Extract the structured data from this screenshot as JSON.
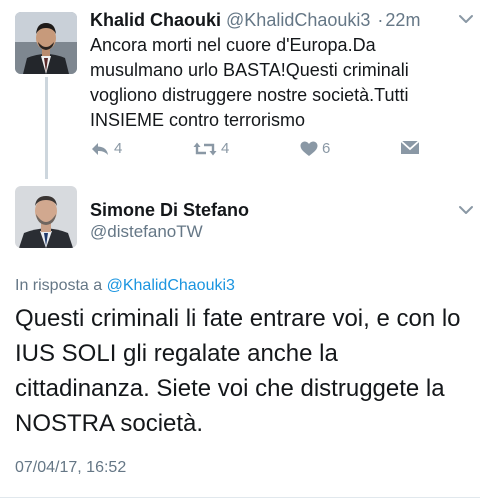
{
  "parent_tweet": {
    "author_name": "Khalid Chaouki",
    "author_handle": "@KhalidChaouki3",
    "separator": "·",
    "time_ago": "22m",
    "text_lines": [
      "Ancora morti nel cuore d'Europa.Da",
      "musulmano urlo BASTA!Questi criminali",
      "vogliono distruggere nostre società.Tutti",
      "INSIEME contro terrorismo"
    ],
    "reply_count": "4",
    "retweet_count": "4",
    "like_count": "6"
  },
  "reply_tweet": {
    "author_name": "Simone Di Stefano",
    "author_handle": "@distefanoTW",
    "in_reply_prefix": "In risposta a",
    "in_reply_handle": "@KhalidChaouki3",
    "text_lines": [
      "Questi criminali li fate entrare voi, e con lo",
      "IUS SOLI gli regalate anche la",
      "cittadinanza. Siete voi che distruggete la",
      "NOSTRA società."
    ],
    "timestamp": "07/04/17, 16:52"
  },
  "colors": {
    "action_icon": "#8a98a5",
    "secondary_text": "#657786",
    "link": "#1b95e0",
    "thread_line": "#cdd6dd"
  },
  "icons": [
    "chevron-down-icon",
    "reply-icon",
    "retweet-icon",
    "heart-icon",
    "direct-message-icon"
  ]
}
